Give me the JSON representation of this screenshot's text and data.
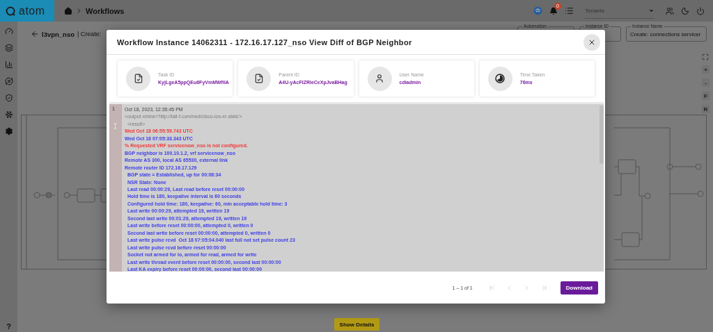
{
  "header": {
    "logo": "atom",
    "breadcrumb": "Workflows",
    "notifications": "0",
    "tenant_select": {
      "placeholder": "Tenants"
    }
  },
  "sidebar": {
    "help": "?"
  },
  "page": {
    "title": "l3vpn_nso",
    "subtitle": "| Create:",
    "fields": [
      {
        "label": "Automation"
      },
      {
        "label": "Instance ID"
      },
      {
        "label": "Instance Name",
        "value": "Create: connections servicer"
      }
    ],
    "zoom_buttons": [
      "+",
      "-",
      "F",
      "R"
    ],
    "show_details": "Show Details"
  },
  "dialog": {
    "title": "Workflow Instance 14062311 - 172.16.17.127_nso View Diff of BGP Neighbor",
    "cards": [
      {
        "kind": "task",
        "label": "Task ID",
        "value": "KyjLgeA5ppQEu6FyVmMWfIlA"
      },
      {
        "kind": "parent",
        "label": "Parent ID",
        "value": "A4U-yAcFIZRleCeXpJvaBHag"
      },
      {
        "kind": "user",
        "label": "User Name",
        "value": "cdiadmin"
      },
      {
        "kind": "time",
        "label": "Time Taken",
        "value": "76ms"
      }
    ],
    "log": {
      "line_number": "1",
      "lines": [
        {
          "kind": "date",
          "text": "Oct 18, 2023, 12:35:45 PM"
        },
        {
          "kind": "xml",
          "text": "<output xmlns='http://tail-f.com/ned/cisco-ios-xr-stats'>"
        },
        {
          "kind": "xml-inner",
          "text": "<result>"
        },
        {
          "kind": "removed",
          "text": "Wed Oct 18 06:55:59.743 UTC"
        },
        {
          "kind": "added",
          "text": "Wed Oct 18 07:05:33.343 UTC"
        },
        {
          "kind": "removed",
          "text": "% Requested VRF servicenow_nso is not configured."
        },
        {
          "kind": "added",
          "text": "BGP neighbor is 100.10.1.2, vrf servicenow_nso"
        },
        {
          "kind": "added",
          "text": "Remote AS 300, local AS 65530, external link"
        },
        {
          "kind": "added",
          "text": "Remote router ID 172.16.17.129"
        },
        {
          "kind": "detail",
          "text": "BGP state = Established, up for 00:08:34"
        },
        {
          "kind": "detail",
          "text": "NSR State: None"
        },
        {
          "kind": "detail",
          "text": "Last read 00:00:29, Last read before reset 00:00:00"
        },
        {
          "kind": "detail",
          "text": "Hold time is 180, keepalive interval is 60 seconds"
        },
        {
          "kind": "detail",
          "text": "Configured hold time: 180, keepalive: 60, min acceptable hold time: 3"
        },
        {
          "kind": "detail",
          "text": "Last write 00:00:29, attempted 19, written 19"
        },
        {
          "kind": "detail",
          "text": "Second last write 00:01:29, attempted 19, written 19"
        },
        {
          "kind": "detail",
          "text": "Last write before reset 00:00:00, attempted 0, written 0"
        },
        {
          "kind": "detail",
          "text": "Second last write before reset 00:00:00, attempted 0, written 0"
        },
        {
          "kind": "detail",
          "text": "Last write pulse rcvd  Oct 18 07:05:04.040 last full not set pulse count 23"
        },
        {
          "kind": "detail",
          "text": "Last write pulse rcvd before reset 00:00:00"
        },
        {
          "kind": "detail",
          "text": "Socket not armed for io, armed for read, armed for write"
        },
        {
          "kind": "detail",
          "text": "Last write thread event before reset 00:00:00, second last 00:00:00"
        },
        {
          "kind": "detail",
          "text": "Last KA expiry before reset 00:00:00, second last 00:00:00"
        }
      ]
    },
    "pagination": "1 – 1 of 1",
    "download": "Download"
  }
}
